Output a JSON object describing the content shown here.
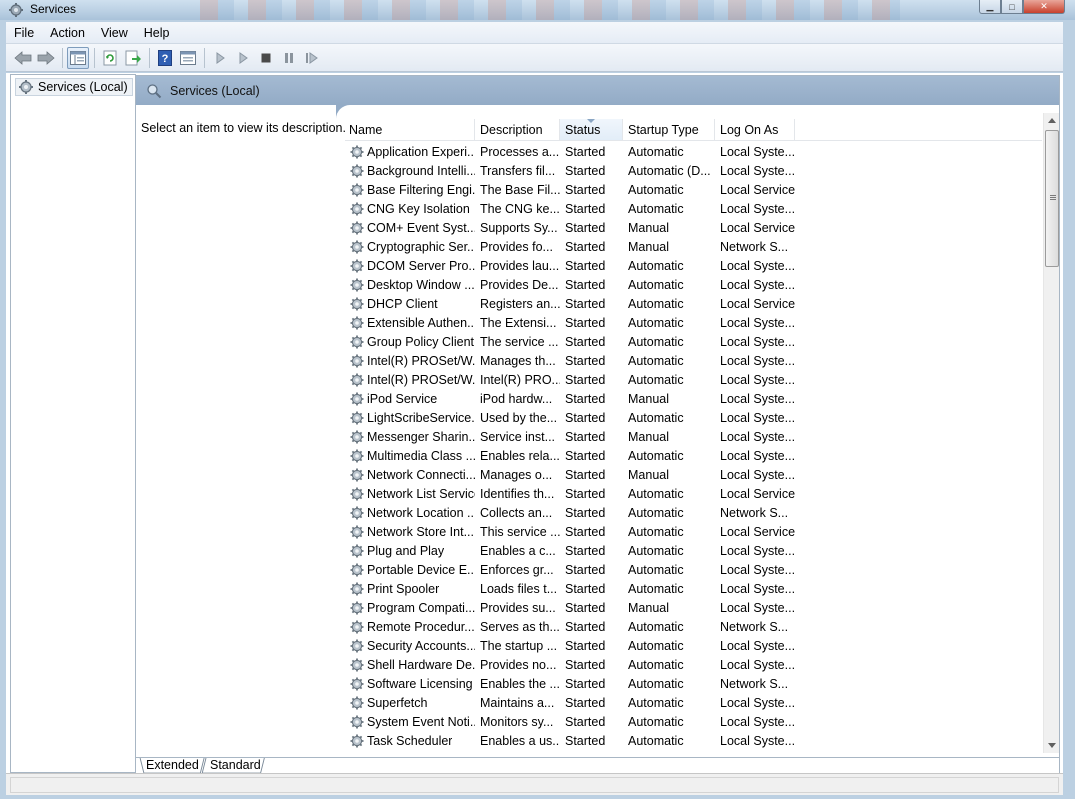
{
  "window": {
    "title": "Services"
  },
  "menu": [
    "File",
    "Action",
    "View",
    "Help"
  ],
  "toolbar": {
    "icons": [
      "back-icon",
      "forward-icon",
      "show-hide-tree-icon",
      "refresh-icon",
      "export-list-icon",
      "help-icon",
      "properties-icon",
      "start-service-icon",
      "start-service-alt-icon",
      "stop-service-icon",
      "pause-service-icon",
      "resume-service-icon"
    ]
  },
  "tree": {
    "root_label": "Services (Local)"
  },
  "main": {
    "header_label": "Services (Local)",
    "description_prompt": "Select an item to view its description."
  },
  "columns": [
    "Name",
    "Description",
    "Status",
    "Startup Type",
    "Log On As"
  ],
  "sorted_column": "Status",
  "rows": [
    [
      "Application Experi...",
      "Processes a...",
      "Started",
      "Automatic",
      "Local Syste..."
    ],
    [
      "Background Intelli...",
      "Transfers fil...",
      "Started",
      "Automatic (D...",
      "Local Syste..."
    ],
    [
      "Base Filtering Engi...",
      "The Base Fil...",
      "Started",
      "Automatic",
      "Local Service"
    ],
    [
      "CNG Key Isolation",
      "The CNG ke...",
      "Started",
      "Automatic",
      "Local Syste..."
    ],
    [
      "COM+ Event Syst...",
      "Supports Sy...",
      "Started",
      "Manual",
      "Local Service"
    ],
    [
      "Cryptographic Ser...",
      "Provides fo...",
      "Started",
      "Manual",
      "Network S..."
    ],
    [
      "DCOM Server Pro...",
      "Provides lau...",
      "Started",
      "Automatic",
      "Local Syste..."
    ],
    [
      "Desktop Window ...",
      "Provides De...",
      "Started",
      "Automatic",
      "Local Syste..."
    ],
    [
      "DHCP Client",
      "Registers an...",
      "Started",
      "Automatic",
      "Local Service"
    ],
    [
      "Extensible Authen...",
      "The Extensi...",
      "Started",
      "Automatic",
      "Local Syste..."
    ],
    [
      "Group Policy Client",
      "The service ...",
      "Started",
      "Automatic",
      "Local Syste..."
    ],
    [
      "Intel(R) PROSet/W...",
      "Manages th...",
      "Started",
      "Automatic",
      "Local Syste..."
    ],
    [
      "Intel(R) PROSet/W...",
      "Intel(R) PRO...",
      "Started",
      "Automatic",
      "Local Syste..."
    ],
    [
      "iPod Service",
      "iPod hardw...",
      "Started",
      "Manual",
      "Local Syste..."
    ],
    [
      "LightScribeService...",
      "Used by the...",
      "Started",
      "Automatic",
      "Local Syste..."
    ],
    [
      "Messenger Sharin...",
      "Service inst...",
      "Started",
      "Manual",
      "Local Syste..."
    ],
    [
      "Multimedia Class ...",
      "Enables rela...",
      "Started",
      "Automatic",
      "Local Syste..."
    ],
    [
      "Network Connecti...",
      "Manages o...",
      "Started",
      "Manual",
      "Local Syste..."
    ],
    [
      "Network List Service",
      "Identifies th...",
      "Started",
      "Automatic",
      "Local Service"
    ],
    [
      "Network Location ...",
      "Collects an...",
      "Started",
      "Automatic",
      "Network S..."
    ],
    [
      "Network Store Int...",
      "This service ...",
      "Started",
      "Automatic",
      "Local Service"
    ],
    [
      "Plug and Play",
      "Enables a c...",
      "Started",
      "Automatic",
      "Local Syste..."
    ],
    [
      "Portable Device E...",
      "Enforces gr...",
      "Started",
      "Automatic",
      "Local Syste..."
    ],
    [
      "Print Spooler",
      "Loads files t...",
      "Started",
      "Automatic",
      "Local Syste..."
    ],
    [
      "Program Compati...",
      "Provides su...",
      "Started",
      "Manual",
      "Local Syste..."
    ],
    [
      "Remote Procedur...",
      "Serves as th...",
      "Started",
      "Automatic",
      "Network S..."
    ],
    [
      "Security Accounts...",
      "The startup ...",
      "Started",
      "Automatic",
      "Local Syste..."
    ],
    [
      "Shell Hardware De...",
      "Provides no...",
      "Started",
      "Automatic",
      "Local Syste..."
    ],
    [
      "Software Licensing",
      "Enables the ...",
      "Started",
      "Automatic",
      "Network S..."
    ],
    [
      "Superfetch",
      "Maintains a...",
      "Started",
      "Automatic",
      "Local Syste..."
    ],
    [
      "System Event Noti...",
      "Monitors sy...",
      "Started",
      "Automatic",
      "Local Syste..."
    ],
    [
      "Task Scheduler",
      "Enables a us...",
      "Started",
      "Automatic",
      "Local Syste..."
    ]
  ],
  "tabs": [
    "Extended",
    "Standard"
  ],
  "active_tab": "Extended",
  "colors": {
    "header_band": "#9fb6cf",
    "frame": "#bcd0e2"
  }
}
